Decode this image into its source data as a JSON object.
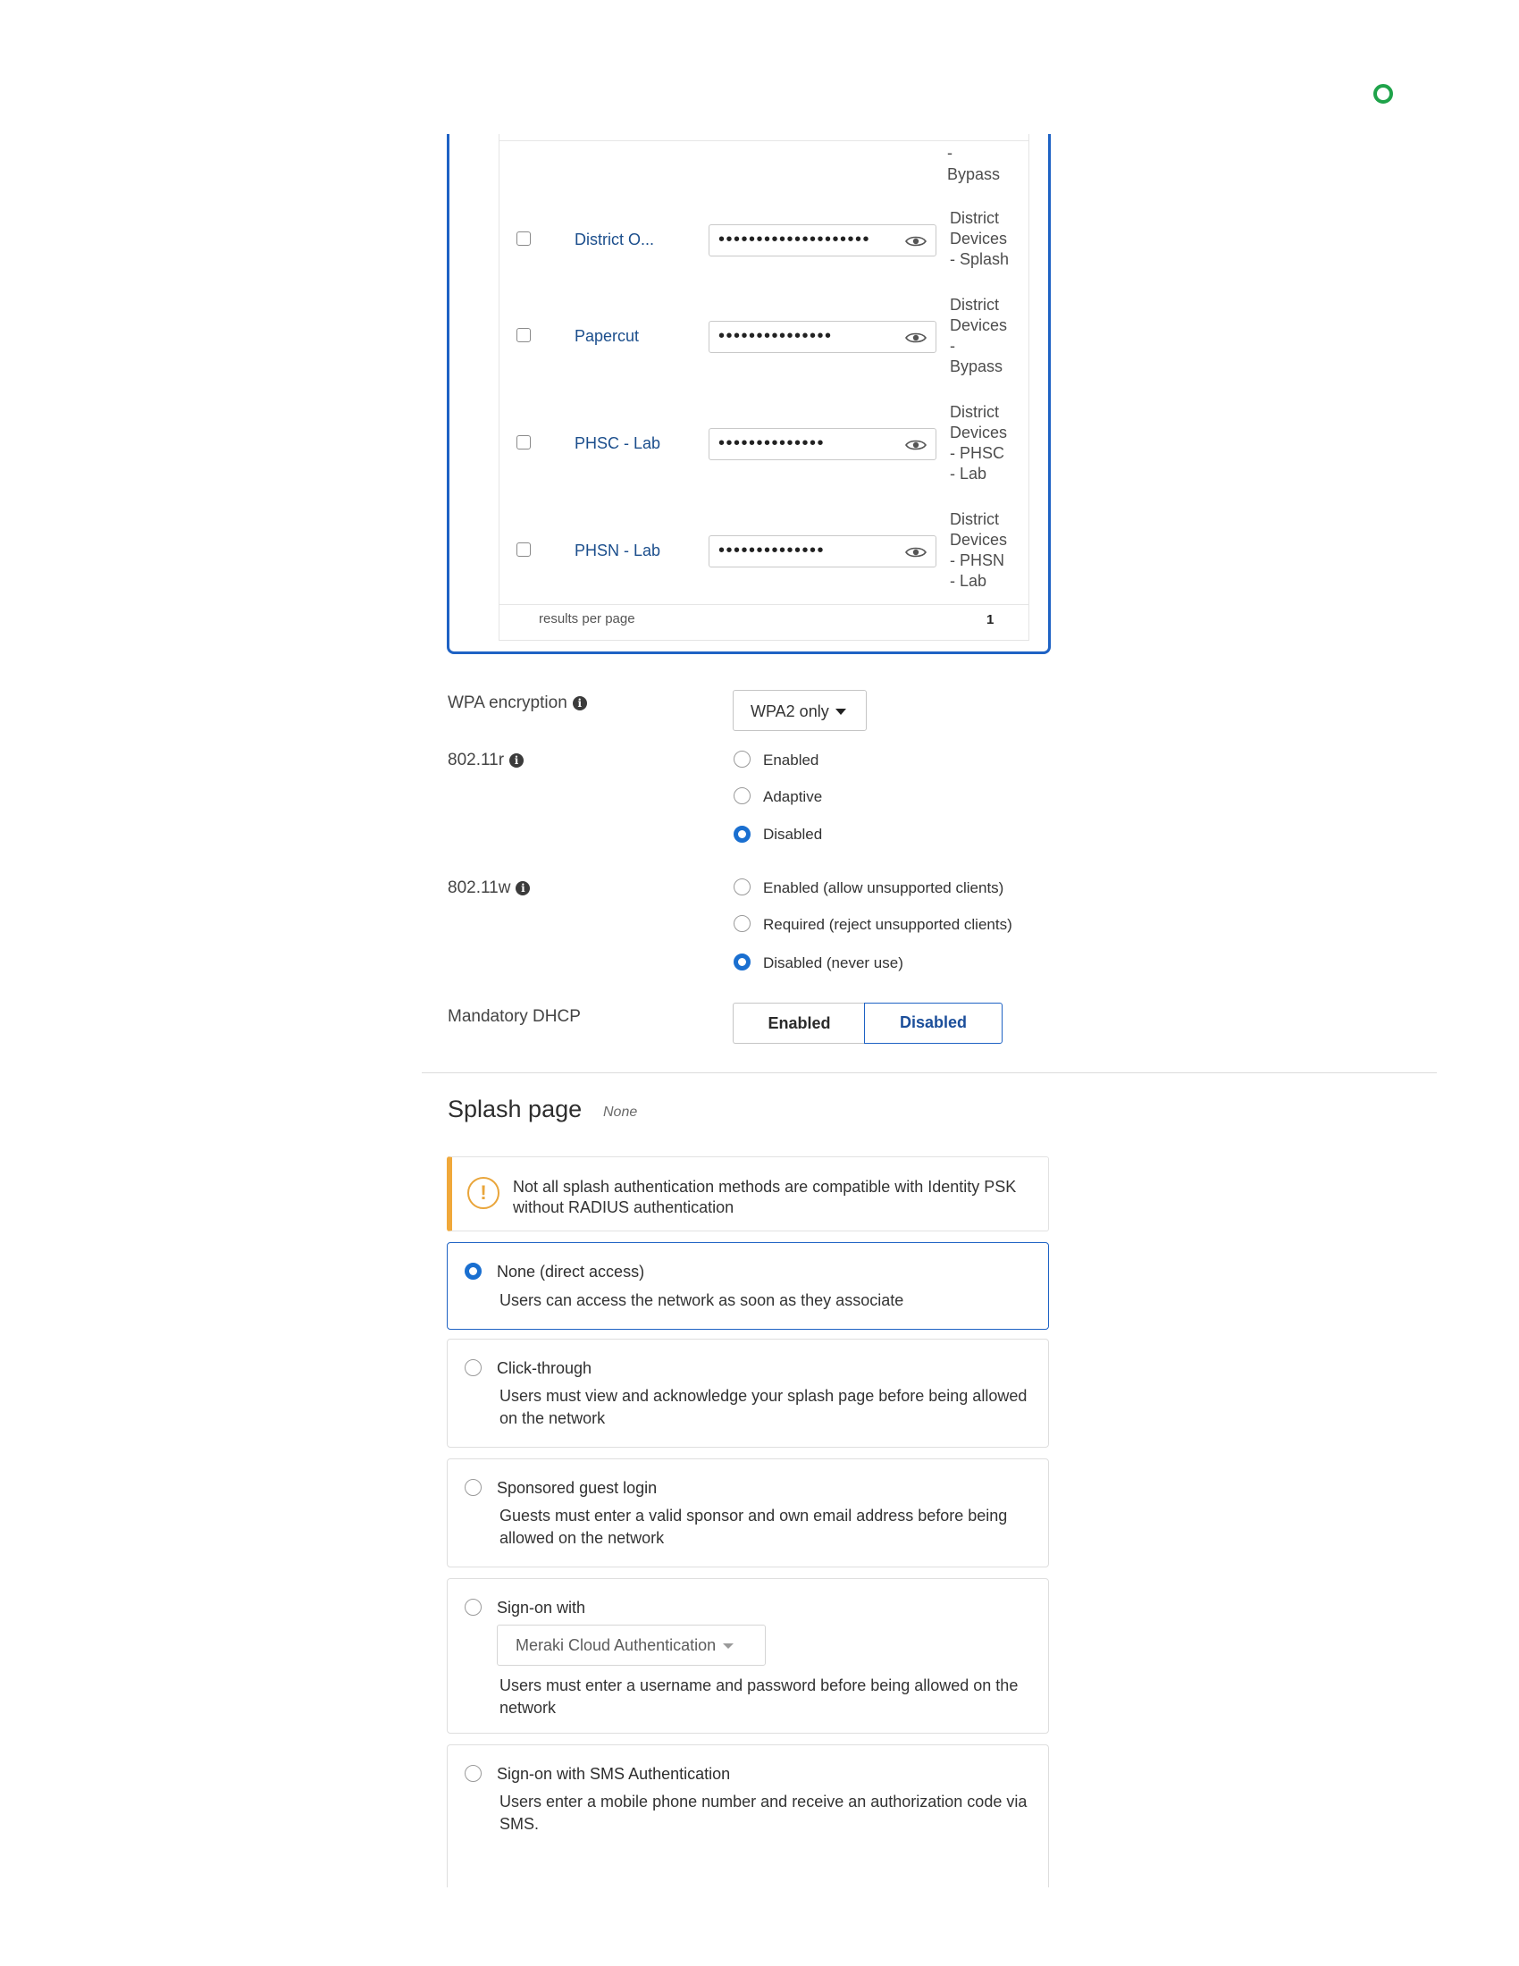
{
  "ipsk_table": {
    "top_group_fragment": [
      "-",
      "Bypass"
    ],
    "rows": [
      {
        "name": "District O...",
        "password_masked": "••••••••••••••••••••",
        "group": [
          "District",
          "Devices",
          "- Splash"
        ]
      },
      {
        "name": "Papercut",
        "password_masked": "•••••••••••••••",
        "group": [
          "District",
          "Devices",
          "-",
          "Bypass"
        ]
      },
      {
        "name": "PHSC - Lab",
        "password_masked": "••••••••••••••",
        "group": [
          "District",
          "Devices",
          "- PHSC",
          "- Lab"
        ]
      },
      {
        "name": "PHSN - Lab",
        "password_masked": "••••••••••••••",
        "group": [
          "District",
          "Devices",
          "- PHSN",
          "- Lab"
        ]
      }
    ],
    "results_label": "results per page",
    "page_number": "1"
  },
  "wpa_encryption": {
    "label": "WPA encryption",
    "selected": "WPA2 only"
  },
  "dot11r": {
    "label": "802.11r",
    "options": [
      {
        "label": "Enabled",
        "selected": false
      },
      {
        "label": "Adaptive",
        "selected": false
      },
      {
        "label": "Disabled",
        "selected": true
      }
    ]
  },
  "dot11w": {
    "label": "802.11w",
    "options": [
      {
        "label": "Enabled (allow unsupported clients)",
        "selected": false
      },
      {
        "label": "Required (reject unsupported clients)",
        "selected": false
      },
      {
        "label": "Disabled (never use)",
        "selected": true
      }
    ]
  },
  "mandatory_dhcp": {
    "label": "Mandatory DHCP",
    "enabled_label": "Enabled",
    "disabled_label": "Disabled",
    "selected": "Disabled"
  },
  "splash_page": {
    "title": "Splash page",
    "current": "None",
    "alert": {
      "icon": "warning-icon",
      "text": "Not all splash authentication methods are compatible with Identity PSK without RADIUS authentication"
    },
    "options": [
      {
        "title": "None (direct access)",
        "desc": "Users can access the network as soon as they associate",
        "selected": true
      },
      {
        "title": "Click-through",
        "desc": "Users must view and acknowledge your splash page before being allowed on the network",
        "selected": false
      },
      {
        "title": "Sponsored guest login",
        "desc": "Guests must enter a valid sponsor and own email address before being allowed on the network",
        "selected": false
      },
      {
        "title": "Sign-on with",
        "dropdown": "Meraki Cloud Authentication",
        "desc": "Users must enter a username and password before being allowed on the network",
        "selected": false
      },
      {
        "title": "Sign-on with SMS Authentication",
        "desc": "Users enter a mobile phone number and receive an authorization code via SMS.",
        "selected": false
      }
    ]
  },
  "colors": {
    "accent_blue": "#1e62c4",
    "radio_selected": "#1a6fd0",
    "warning_orange": "#f0a83a",
    "status_green": "#1fa34a",
    "link_blue": "#1b4e8c"
  }
}
